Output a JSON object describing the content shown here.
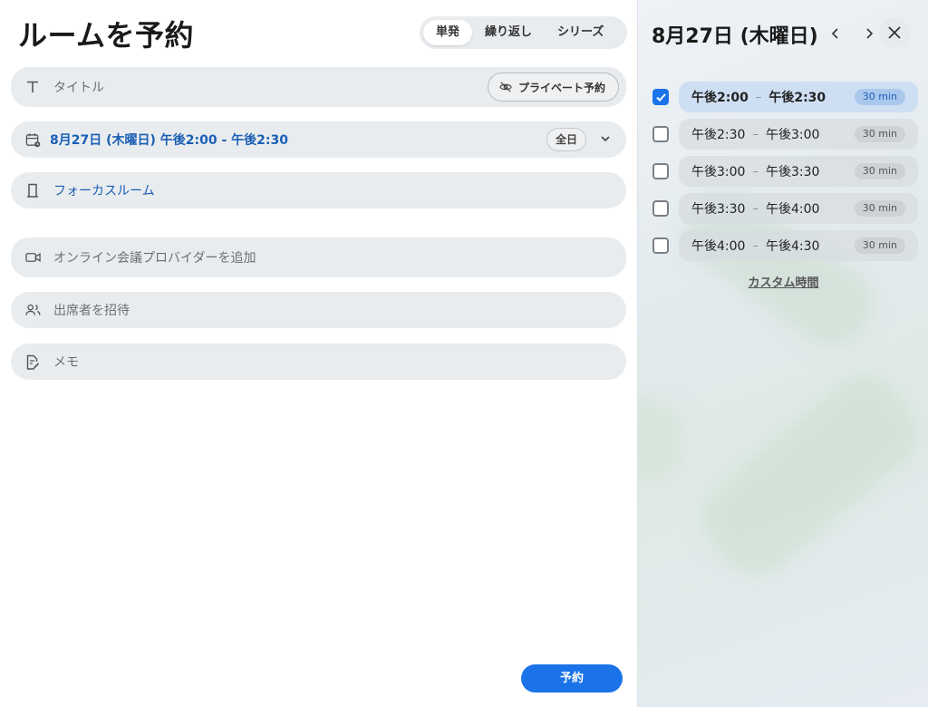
{
  "header": {
    "title": "ルームを予約",
    "tabs": [
      {
        "label": "単発",
        "active": true
      },
      {
        "label": "繰り返し",
        "active": false
      },
      {
        "label": "シリーズ",
        "active": false
      }
    ]
  },
  "form": {
    "title_placeholder": "タイトル",
    "private_label": "プライベート予約",
    "datetime_value": "8月27日 (木曜日) 午後2:00 - 午後2:30",
    "allday_label": "全日",
    "room_value": "フォーカスルーム",
    "conference_placeholder": "オンライン会議プロバイダーを追加",
    "attendees_placeholder": "出席者を招待",
    "memo_placeholder": "メモ",
    "submit_label": "予約"
  },
  "sidebar": {
    "date_title": "8月27日 (木曜日)",
    "slots": [
      {
        "start": "午後2:00",
        "end": "午後2:30",
        "duration": "30 min",
        "checked": true
      },
      {
        "start": "午後2:30",
        "end": "午後3:00",
        "duration": "30 min",
        "checked": false
      },
      {
        "start": "午後3:00",
        "end": "午後3:30",
        "duration": "30 min",
        "checked": false
      },
      {
        "start": "午後3:30",
        "end": "午後4:00",
        "duration": "30 min",
        "checked": false
      },
      {
        "start": "午後4:00",
        "end": "午後4:30",
        "duration": "30 min",
        "checked": false
      }
    ],
    "custom_time_label": "カスタム時間"
  },
  "colors": {
    "accent": "#1a73e8",
    "link_text": "#1a5fb4",
    "field_bg": "#e9ecef"
  }
}
